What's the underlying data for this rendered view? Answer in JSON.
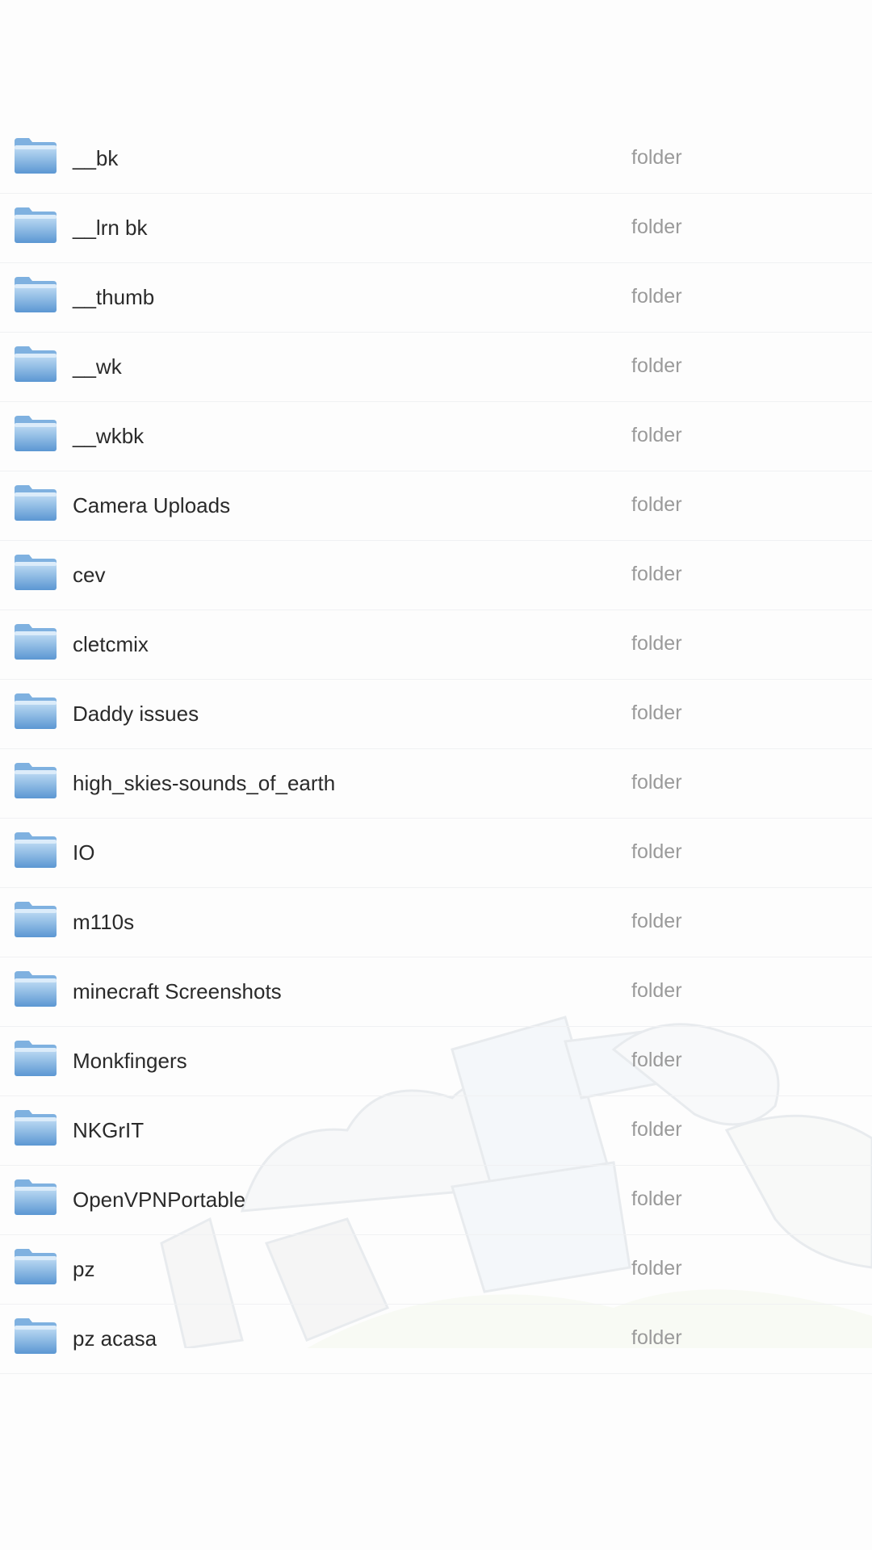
{
  "file_list": {
    "items": [
      {
        "name": "__bk",
        "kind": "folder",
        "icon": "folder-icon"
      },
      {
        "name": "__lrn bk",
        "kind": "folder",
        "icon": "folder-icon"
      },
      {
        "name": "__thumb",
        "kind": "folder",
        "icon": "folder-icon"
      },
      {
        "name": "__wk",
        "kind": "folder",
        "icon": "folder-icon"
      },
      {
        "name": "__wkbk",
        "kind": "folder",
        "icon": "folder-icon"
      },
      {
        "name": "Camera Uploads",
        "kind": "folder",
        "icon": "folder-icon"
      },
      {
        "name": "cev",
        "kind": "folder",
        "icon": "folder-icon"
      },
      {
        "name": "cletcmix",
        "kind": "folder",
        "icon": "folder-icon"
      },
      {
        "name": "Daddy issues",
        "kind": "folder",
        "icon": "folder-icon"
      },
      {
        "name": "high_skies-sounds_of_earth",
        "kind": "folder",
        "icon": "folder-icon"
      },
      {
        "name": "IO",
        "kind": "folder",
        "icon": "folder-icon"
      },
      {
        "name": "m110s",
        "kind": "folder",
        "icon": "folder-icon"
      },
      {
        "name": "minecraft Screenshots",
        "kind": "folder",
        "icon": "folder-icon"
      },
      {
        "name": "Monkfingers",
        "kind": "folder",
        "icon": "folder-icon"
      },
      {
        "name": "NKGrIT",
        "kind": "folder",
        "icon": "folder-icon"
      },
      {
        "name": "OpenVPNPortable",
        "kind": "folder",
        "icon": "folder-icon"
      },
      {
        "name": "pz",
        "kind": "folder",
        "icon": "folder-icon"
      },
      {
        "name": "pz acasa",
        "kind": "folder",
        "icon": "folder-icon"
      }
    ]
  },
  "colors": {
    "background": "#fdfdfd",
    "folder_top": "#b9d9f3",
    "folder_bottom": "#5f9bd6",
    "name_text": "#2a2a2a",
    "kind_text": "#9a9a9a"
  }
}
